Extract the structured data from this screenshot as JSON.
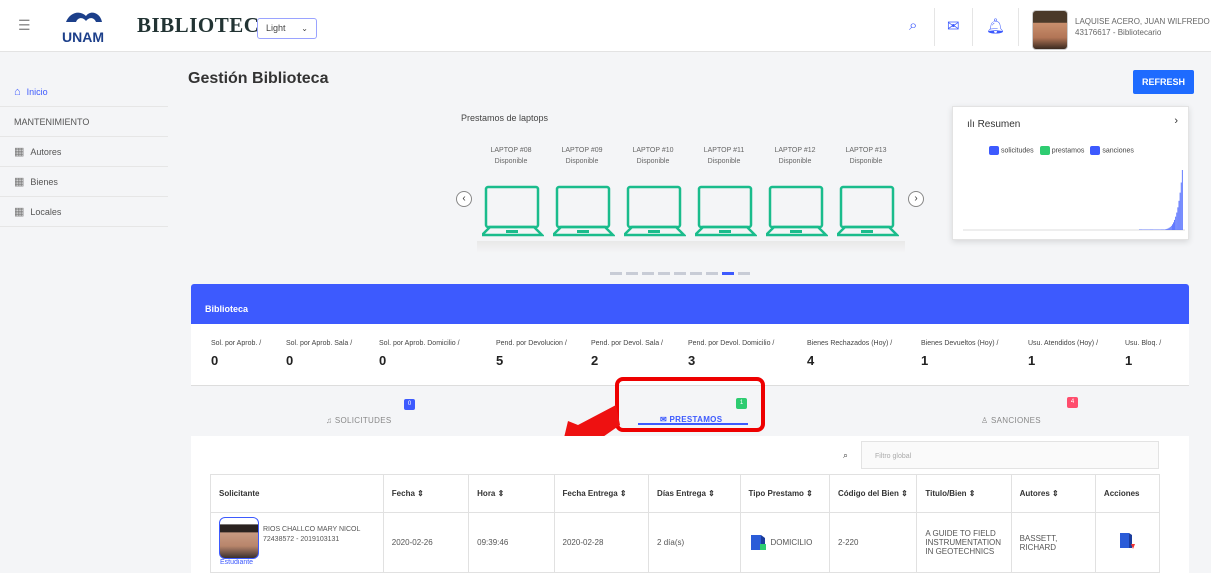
{
  "header": {
    "brand": "BIBLIOTECA",
    "logo_text": "UNAM",
    "theme_select": "Light",
    "user_name": "LAQUISE ACERO, JUAN WILFREDO",
    "user_sub": "43176617 - Bibliotecario"
  },
  "sidebar": {
    "items": [
      {
        "label": "Inicio",
        "icon": "home-icon"
      },
      {
        "label": "MANTENIMIENTO"
      },
      {
        "label": "Autores",
        "icon": "table-icon"
      },
      {
        "label": "Bienes",
        "icon": "table-icon"
      },
      {
        "label": "Locales",
        "icon": "table-icon"
      }
    ]
  },
  "page": {
    "title": "Gestión Biblioteca",
    "refresh": "REFRESH"
  },
  "laptops": {
    "title": "Prestamos de laptops",
    "items": [
      {
        "name": "LAPTOP #08",
        "status": "Disponible"
      },
      {
        "name": "LAPTOP #09",
        "status": "Disponible"
      },
      {
        "name": "LAPTOP #10",
        "status": "Disponible"
      },
      {
        "name": "LAPTOP #11",
        "status": "Disponible"
      },
      {
        "name": "LAPTOP #12",
        "status": "Disponible"
      },
      {
        "name": "LAPTOP #13",
        "status": "Disponible"
      }
    ],
    "active_page": 7,
    "pages": 9
  },
  "resumen": {
    "title": "Resumen",
    "legend": [
      {
        "label": "solicitudes",
        "color": "#3d5afe"
      },
      {
        "label": "prestamos",
        "color": "#2ecc71"
      },
      {
        "label": "sanciones",
        "color": "#3d5afe"
      }
    ]
  },
  "panel": {
    "title": "Biblioteca"
  },
  "stats": [
    {
      "label": "Sol. por Aprob. /",
      "value": "0"
    },
    {
      "label": "Sol. por Aprob. Sala /",
      "value": "0"
    },
    {
      "label": "Sol. por Aprob. Domicilio /",
      "value": "0"
    },
    {
      "label": "Pend. por Devolucion /",
      "value": "5"
    },
    {
      "label": "Pend. por Devol. Sala /",
      "value": "2"
    },
    {
      "label": "Pend. por Devol. Domicilio /",
      "value": "3"
    },
    {
      "label": "Bienes Rechazados (Hoy) /",
      "value": "4"
    },
    {
      "label": "Bienes Devueltos (Hoy) /",
      "value": "1"
    },
    {
      "label": "Usu. Atendidos (Hoy) /",
      "value": "1"
    },
    {
      "label": "Usu. Bloq. /",
      "value": "1"
    }
  ],
  "tabs": [
    {
      "label": "SOLICITUDES",
      "badge": "0",
      "badge_color": "#3d5afe"
    },
    {
      "label": "PRESTAMOS",
      "badge": "1",
      "badge_color": "#2ecc71"
    },
    {
      "label": "SANCIONES",
      "badge": "4",
      "badge_color": "#ff4d6d"
    }
  ],
  "filter": {
    "placeholder": "Filtro global"
  },
  "table": {
    "headers": [
      "Solicitante",
      "Fecha ⇕",
      "Hora ⇕",
      "Fecha Entrega ⇕",
      "Días Entrega ⇕",
      "Tipo Prestamo ⇕",
      "Código del Bien ⇕",
      "Titulo/Bien ⇕",
      "Autores ⇕",
      "Acciones"
    ],
    "row": {
      "solicitante_name": "RIOS CHALLCO MARY NICOL",
      "solicitante_id": "72438572 - 2019103131",
      "solicitante_type": "Estudiante",
      "fecha": "2020-02-26",
      "hora": "09:39:46",
      "fecha_entrega": "2020-02-28",
      "dias": "2 día(s)",
      "tipo": "DOMICILIO",
      "codigo": "2-220",
      "titulo": "A GUIDE TO FIELD INSTRUMENTATION IN GEOTECHNICS",
      "autores": "BASSETT, RICHARD"
    }
  }
}
